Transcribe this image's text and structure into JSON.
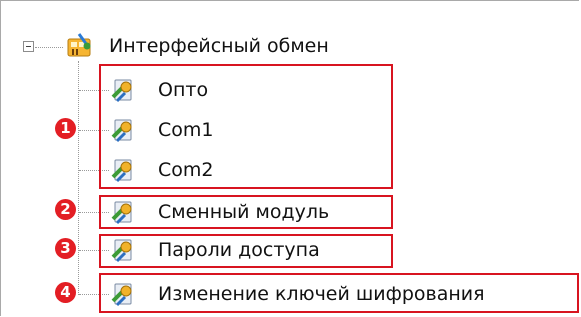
{
  "tree": {
    "root": {
      "label": "Интерфейсный обмен",
      "icon": "network-settings-icon",
      "expanded": true
    },
    "children": [
      {
        "label": "Опто",
        "icon": "settings-node-icon"
      },
      {
        "label": "Com1",
        "icon": "settings-node-icon"
      },
      {
        "label": "Com2",
        "icon": "settings-node-icon"
      },
      {
        "label": "Сменный модуль",
        "icon": "settings-node-icon"
      },
      {
        "label": "Пароли доступа",
        "icon": "settings-node-icon"
      },
      {
        "label": "Изменение ключей шифрования",
        "icon": "settings-node-icon"
      }
    ]
  },
  "annotations": {
    "badges": [
      "1",
      "2",
      "3",
      "4"
    ],
    "highlight_color": "#d81420",
    "badge_color": "#e31e24"
  }
}
